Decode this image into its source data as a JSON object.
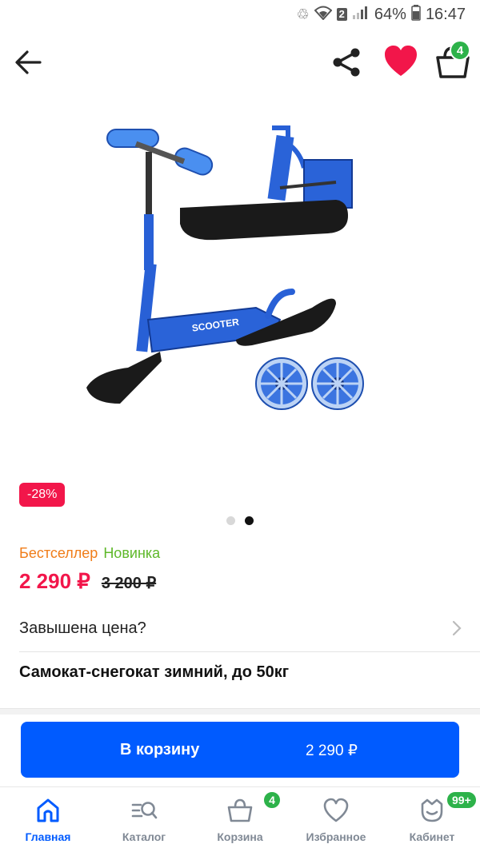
{
  "status_bar": {
    "battery": "64%",
    "time": "16:47",
    "sim_slot": "2"
  },
  "header": {
    "cart_count": "4",
    "icons": [
      "back-arrow-icon",
      "share-icon",
      "heart-icon",
      "basket-icon"
    ],
    "favorite_color": "#f2164a"
  },
  "product": {
    "discount": "-28%",
    "gallery_pages": 2,
    "gallery_active": 2,
    "tags": [
      "Бестселлер",
      "Новинка"
    ],
    "price": "2 290 ₽",
    "old_price": "3 200 ₽",
    "price_complaint": "Завышена цена?",
    "title": "Самокат-снегокат зимний, до 50кг"
  },
  "cta": {
    "label": "В корзину",
    "price": "2 290 ₽",
    "color": "#005bff"
  },
  "bottom_nav": [
    {
      "label": "Главная",
      "icon": "home-icon",
      "active": true
    },
    {
      "label": "Каталог",
      "icon": "catalog-search-icon"
    },
    {
      "label": "Корзина",
      "icon": "basket-icon",
      "badge": "4"
    },
    {
      "label": "Избранное",
      "icon": "heart-outline-icon"
    },
    {
      "label": "Кабинет",
      "icon": "profile-icon",
      "badge": "99+"
    }
  ]
}
